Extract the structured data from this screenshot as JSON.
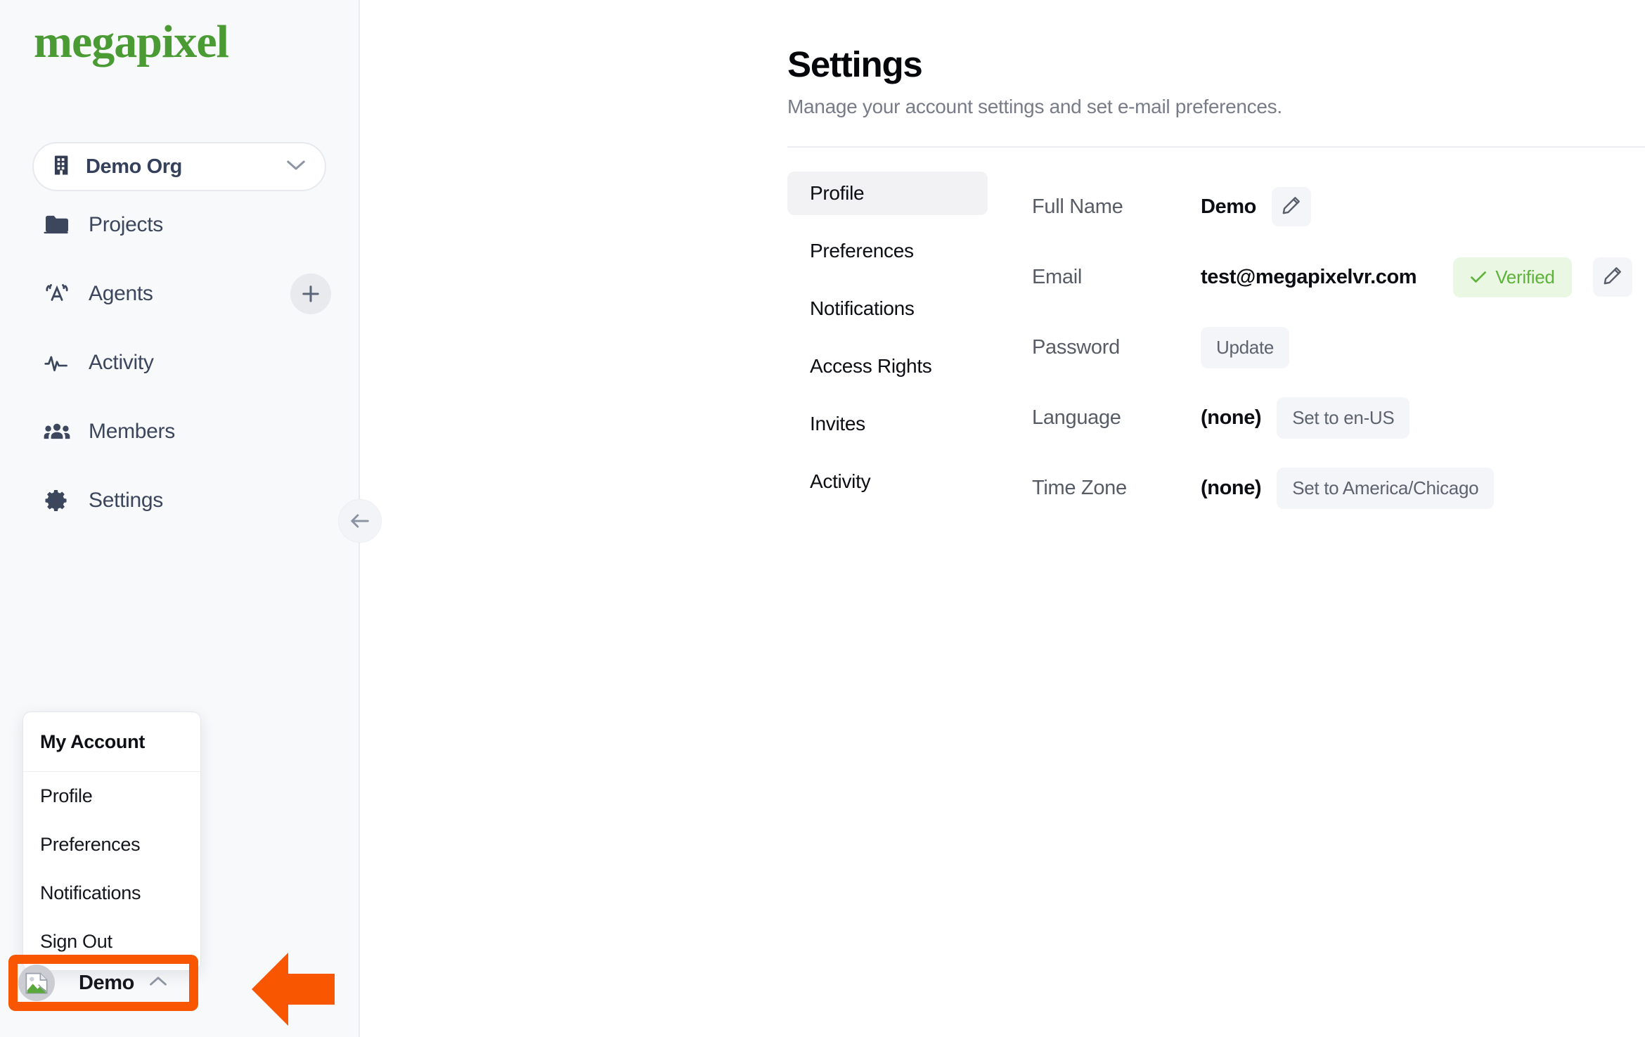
{
  "brand": {
    "logo_text": "megapixel",
    "logo_color": "#4a9b34"
  },
  "sidebar": {
    "org_selector": {
      "name": "Demo Org",
      "icon": "building-icon",
      "chevron": "chevron-down-icon"
    },
    "nav_items": [
      {
        "label": "Projects",
        "icon": "folder-icon"
      },
      {
        "label": "Agents",
        "icon": "broadcast-icon"
      },
      {
        "label": "Activity",
        "icon": "pulse-icon"
      },
      {
        "label": "Members",
        "icon": "users-icon"
      },
      {
        "label": "Settings",
        "icon": "gear-icon"
      }
    ],
    "add_agent_label": "+",
    "collapse_label": "←",
    "account_menu": {
      "title": "My Account",
      "items": [
        "Profile",
        "Preferences",
        "Notifications",
        "Sign Out"
      ]
    },
    "user_button": {
      "name": "Demo",
      "chevron": "chevron-up-icon",
      "avatar": "broken-image-placeholder"
    }
  },
  "main": {
    "title": "Settings",
    "subtitle": "Manage your account settings and set e-mail preferences.",
    "tabs": [
      {
        "label": "Profile",
        "active": true
      },
      {
        "label": "Preferences",
        "active": false
      },
      {
        "label": "Notifications",
        "active": false
      },
      {
        "label": "Access Rights",
        "active": false
      },
      {
        "label": "Invites",
        "active": false
      },
      {
        "label": "Activity",
        "active": false
      }
    ],
    "fields": {
      "full_name": {
        "label": "Full Name",
        "value": "Demo",
        "edit_icon": "pencil-icon"
      },
      "email": {
        "label": "Email",
        "value": "test@megapixelvr.com",
        "badge": "Verified",
        "badge_icon": "check-icon",
        "edit_icon": "pencil-icon"
      },
      "password": {
        "label": "Password",
        "action": "Update"
      },
      "language": {
        "label": "Language",
        "value": "(none)",
        "action": "Set to en-US"
      },
      "timezone": {
        "label": "Time Zone",
        "value": "(none)",
        "action": "Set to America/Chicago"
      }
    }
  },
  "annotation": {
    "highlight_color": "#f95601",
    "arrow": "left-arrow-annotation",
    "target": "user-account-button"
  }
}
